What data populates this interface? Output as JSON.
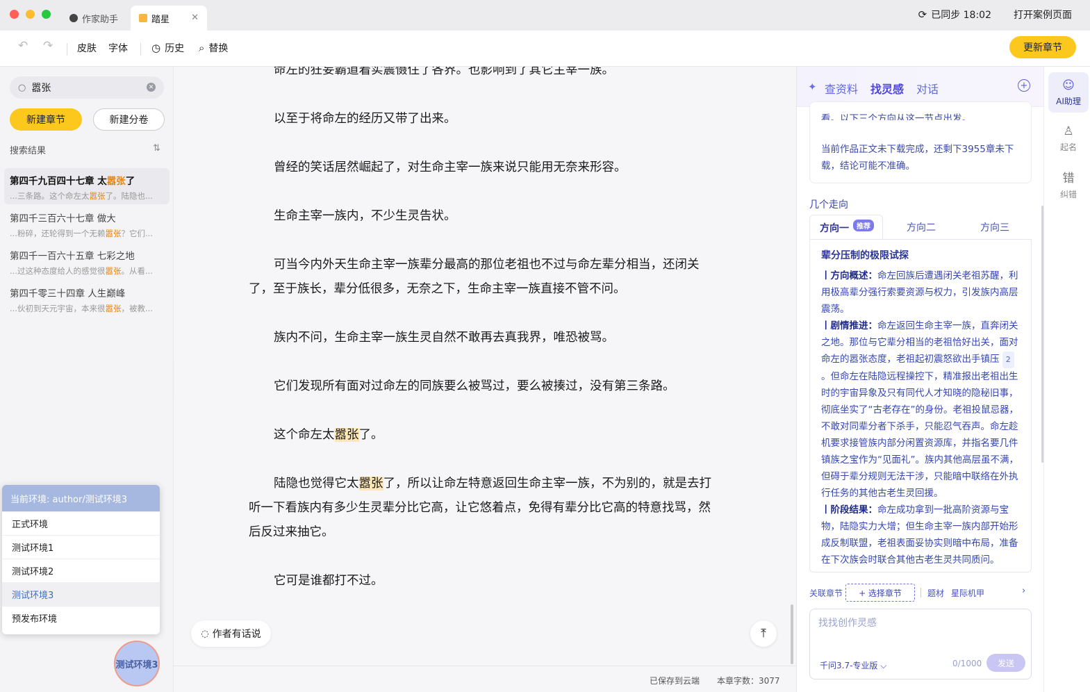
{
  "titlebar": {
    "tabs": [
      {
        "label": "作家助手",
        "active": false
      },
      {
        "label": "踏星",
        "active": true
      }
    ],
    "close_glyph": "✕",
    "sync_status": "已同步 18:02",
    "open_case_page": "打开案例页面"
  },
  "toolbar": {
    "undo_glyph": "↶",
    "redo_glyph": "↷",
    "skin": "皮肤",
    "font": "字体",
    "history": "历史",
    "replace": "替换",
    "update_chapter": "更新章节"
  },
  "sidebar": {
    "search": {
      "value": "嚣张",
      "placeholder": "",
      "icon": "search-icon"
    },
    "new_chapter": "新建章节",
    "new_volume": "新建分卷",
    "results_label": "搜索结果",
    "sort_glyph": "⇅",
    "results": [
      {
        "title_pre": "第四千九百四十七章 太",
        "title_hl": "嚣张",
        "title_post": "了",
        "snip_pre": "...三条路。这个命左太",
        "snip_hl": "嚣张",
        "snip_post": "了。陆隐也..."
      },
      {
        "title_pre": "第四千三百六十七章 做大",
        "title_hl": "",
        "title_post": "",
        "snip_pre": "...粉碎，还轮得到一个无赖",
        "snip_hl": "嚣张",
        "snip_post": "？它们..."
      },
      {
        "title_pre": "第四千一百六十五章 七彩之地",
        "title_hl": "",
        "title_post": "",
        "snip_pre": "...过这种态度给人的感觉很",
        "snip_hl": "嚣张",
        "snip_post": "。从看..."
      },
      {
        "title_pre": "第四千零三十四章 人生巅峰",
        "title_hl": "",
        "title_post": "",
        "snip_pre": "...伙初到天元宇宙，本来很",
        "snip_hl": "嚣张",
        "snip_post": "，被教..."
      }
    ],
    "env": {
      "current": "当前环境: author/测试环境3",
      "options": [
        "正式环境",
        "测试环境1",
        "测试环境2",
        "测试环境3",
        "预发布环境"
      ],
      "selected": "测试环境3",
      "fab_label": "测试环境3"
    }
  },
  "editor": {
    "paragraphs": [
      {
        "text": "命左的狂妄霸道着实震慑住了各界。也影响到了其它主宰一族。"
      },
      {
        "text": "以至于将命左的经历又带了出来。"
      },
      {
        "text": "曾经的笑话居然崛起了，对生命主宰一族来说只能用无奈来形容。"
      },
      {
        "text": "生命主宰一族内，不少生灵告状。"
      },
      {
        "text": "可当今内外天生命主宰一族辈分最高的那位老祖也不过与命左辈分相当，还闭关了，至于族长，辈分低很多，无奈之下，生命主宰一族直接不管不问。"
      },
      {
        "text": "族内不问，生命主宰一族生灵自然不敢再去真我界，唯恐被骂。"
      },
      {
        "text": "它们发现所有面对过命左的同族要么被骂过，要么被揍过，没有第三条路。"
      },
      {
        "pre": "这个命左太",
        "hl": "嚣张",
        "post": "了。"
      },
      {
        "pre": "陆隐也觉得它太",
        "hl": "嚣张",
        "post": "了，所以让命左特意返回生命主宰一族，不为别的，就是去打听一下看族内有多少生灵辈分比它高，让它悠着点，免得有辈分比它高的特意找骂，然后反过来抽它。"
      },
      {
        "text": "它可是谁都打不过。"
      }
    ],
    "author_note": "作者有话说",
    "to_top_glyph": "⤒",
    "saved": "已保存到云端",
    "word_count": "本章字数：3077"
  },
  "ai": {
    "tabs": [
      "查资料",
      "找灵感",
      "对话"
    ],
    "active_tab": "找灵感",
    "notice_top": "看。以下三个方向从这一节点出发。",
    "notice": "当前作品正文未下载完成，还剩下3955章未下载，结论可能不准确。",
    "directions_label": "几个走向",
    "direction_tabs": [
      "方向一",
      "方向二",
      "方向三"
    ],
    "recommend_badge": "推荐",
    "direction_title": "辈分压制的极限试探",
    "sections": [
      {
        "heading": "丨方向概述：",
        "body": "命左回族后遭遇闭关老祖苏醒，利用极高辈分强行索要资源与权力，引发族内高层震荡。"
      },
      {
        "heading": "丨剧情推进：",
        "body_pre": "命左返回生命主宰一族，直奔闭关之地。那位与它辈分相当的老祖恰好出关，面对命左的嚣张态度，老祖起初震怒欲出手镇压",
        "ref": "2",
        "body_post": "。但命左在陆隐远程操控下，精准报出老祖出生时的宇宙异象及只有同代人才知晓的隐秘旧事，彻底坐实了“古老存在”的身份。老祖投鼠忌器，不敢对同辈分者下杀手，只能忍气吞声。命左趁机要求接管族内部分闲置资源库，并指名要几件镇族之宝作为“见面礼”。族内其他高层虽不满，但碍于辈分规则无法干涉，只能暗中联络在外执行任务的其他古老生灵回援。"
      },
      {
        "heading": "丨阶段结果：",
        "body": "命左成功拿到一批高阶资源与宝物，陆隐实力大增；但生命主宰一族内部开始形成反制联盟，老祖表面妥协实则暗中布局，准备在下次族会时联合其他古老生灵共同质问。"
      }
    ],
    "assoc_label": "关联章节",
    "choose_chapter": "+ 选择章节",
    "theme_label": "题材",
    "theme_value": "星际机甲",
    "input_placeholder": "找找创作灵感",
    "model": "千问3.7-专业版 ⌵",
    "char_count": "0/1000",
    "send": "发送"
  },
  "rail": {
    "items": [
      {
        "label": "AI助理",
        "icon": "ai-assistant-icon",
        "active": true
      },
      {
        "label": "起名",
        "icon": "naming-icon",
        "active": false
      },
      {
        "label": "纠错",
        "icon": "proofread-icon",
        "active": false
      }
    ]
  },
  "colors": {
    "accent_yellow": "#fcc81e",
    "ai_purple": "#5a55e0",
    "highlight_orange": "#e8840c"
  }
}
